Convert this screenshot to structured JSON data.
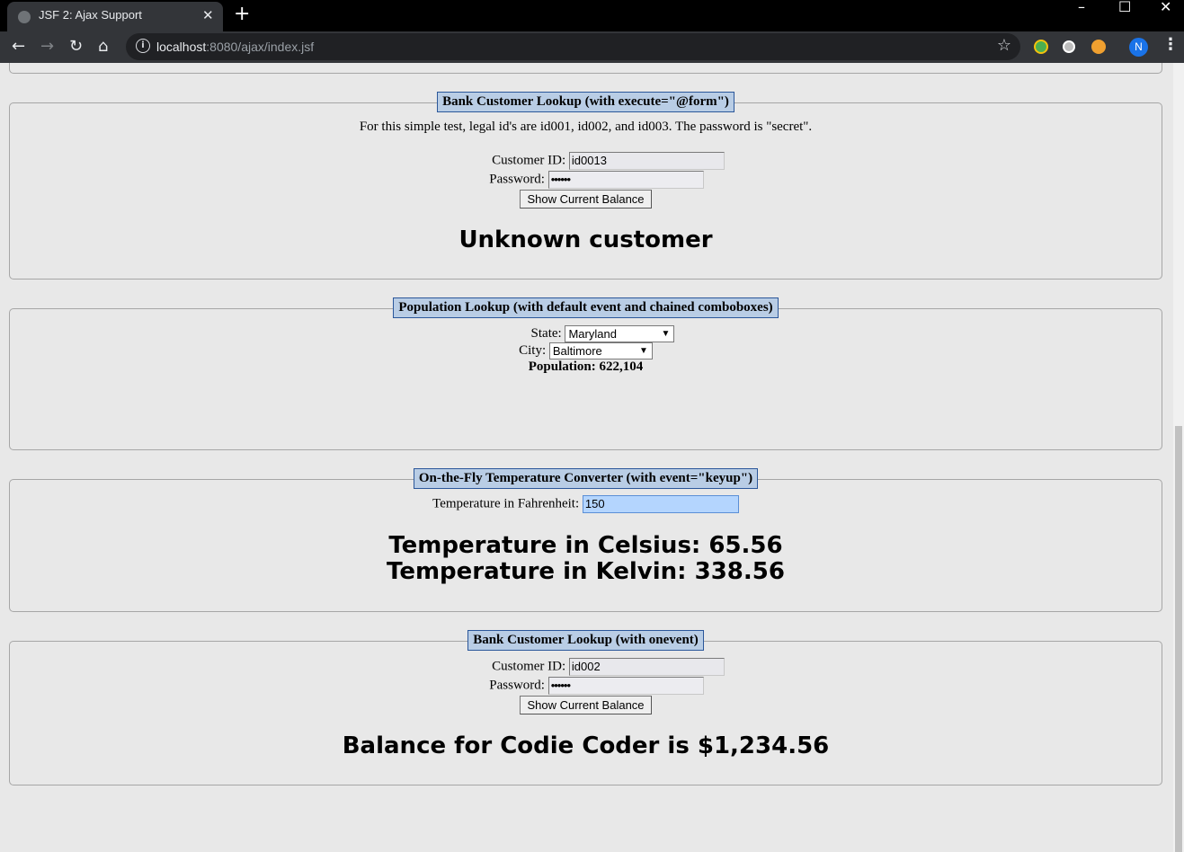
{
  "browser": {
    "tab_title": "JSF 2: Ajax Support",
    "url_host": "localhost",
    "url_path": ":8080/ajax/index.jsf",
    "avatar_letter": "N"
  },
  "sections": {
    "bank1": {
      "legend": "Bank Customer Lookup (with execute=\"@form\")",
      "note": "For this simple test, legal id's are id001, id002, and id003. The password is \"secret\".",
      "customer_id_label": "Customer ID:",
      "customer_id_value": "id0013",
      "password_label": "Password:",
      "password_value": "••••••",
      "button_label": "Show Current Balance",
      "result": "Unknown customer"
    },
    "population": {
      "legend": "Population Lookup (with default event and chained comboboxes)",
      "state_label": "State:",
      "state_value": "Maryland",
      "city_label": "City:",
      "city_value": "Baltimore",
      "result": "Population: 622,104"
    },
    "temperature": {
      "legend": "On-the-Fly Temperature Converter (with event=\"keyup\")",
      "input_label": "Temperature in Fahrenheit:",
      "input_value": "150",
      "celsius": "Temperature in Celsius: 65.56",
      "kelvin": "Temperature in Kelvin: 338.56"
    },
    "bank2": {
      "legend": "Bank Customer Lookup (with onevent)",
      "customer_id_label": "Customer ID:",
      "customer_id_value": "id002",
      "password_label": "Password:",
      "password_value": "••••••",
      "button_label": "Show Current Balance",
      "result": "Balance for Codie Coder is $1,234.56"
    }
  },
  "colors": {
    "legend_bg": "#b9cde5",
    "legend_border": "#2b579a",
    "page_bg": "#e8e8e8",
    "focus_bg": "#b4d5fe"
  }
}
